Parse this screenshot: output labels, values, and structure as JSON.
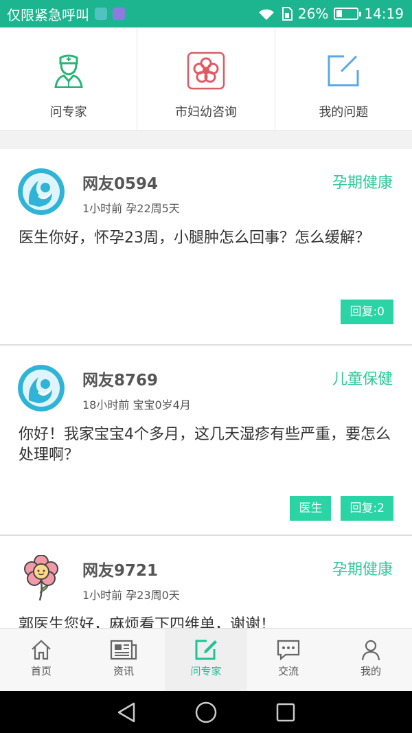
{
  "status_bar": {
    "carrier": "仅限紧急呼叫",
    "battery_percent": "26%",
    "battery_level": 0.26,
    "time": "14:19",
    "bg_color": "#1db58f"
  },
  "shortcuts": [
    {
      "label": "问专家",
      "icon": "doctor-icon"
    },
    {
      "label": "市妇幼咨询",
      "icon": "flower-badge-icon"
    },
    {
      "label": "我的问题",
      "icon": "edit-square-icon"
    }
  ],
  "posts": [
    {
      "user": "网友0594",
      "meta": "1小时前 孕22周5天",
      "category": "孕期健康",
      "content": "医生你好，怀孕23周，小腿肿怎么回事？怎么缓解？",
      "avatar": "mother-baby-avatar-icon",
      "doctor_label": "",
      "reply_label": "回复:0"
    },
    {
      "user": "网友8769",
      "meta": "18小时前 宝宝0岁4月",
      "category": "儿童保健",
      "content": "你好！我家宝宝4个多月，这几天湿疹有些严重，要怎么处理啊？",
      "avatar": "mother-baby-avatar-icon",
      "doctor_label": "医生",
      "reply_label": "回复:2"
    },
    {
      "user": "网友9721",
      "meta": "1小时前 孕23周0天",
      "category": "孕期健康",
      "content": "郭医生您好，麻烦看下四维单，谢谢！",
      "avatar": "flower-avatar-icon",
      "doctor_label": "",
      "reply_label": ""
    }
  ],
  "bottom_nav": [
    {
      "label": "首页",
      "icon": "home-icon",
      "active": false
    },
    {
      "label": "资讯",
      "icon": "news-icon",
      "active": false
    },
    {
      "label": "问专家",
      "icon": "edit-square-icon",
      "active": true
    },
    {
      "label": "交流",
      "icon": "chat-icon",
      "active": false
    },
    {
      "label": "我的",
      "icon": "user-icon",
      "active": false
    }
  ],
  "colors": {
    "accent": "#2ec99a",
    "tag_bg": "#2ad4a5",
    "doctor_icon": "#27b574",
    "flower_badge": "#e05a63",
    "edit_icon": "#5aa9e6"
  }
}
